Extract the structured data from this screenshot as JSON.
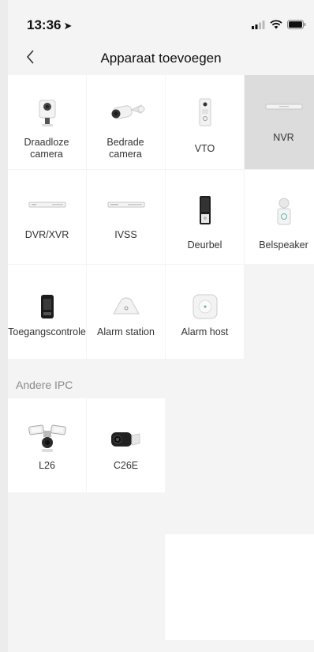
{
  "status": {
    "time": "13:36",
    "location_icon": "location-arrow-icon"
  },
  "nav": {
    "back_icon": "chevron-left-icon",
    "title": "Apparaat toevoegen"
  },
  "devices": [
    {
      "label": "Draadloze camera",
      "icon": "wireless-camera-icon"
    },
    {
      "label": "Bedrade camera",
      "icon": "bullet-camera-icon"
    },
    {
      "label": "VTO",
      "icon": "door-station-icon"
    },
    {
      "label": "NVR",
      "icon": "nvr-recorder-icon",
      "selected": true
    },
    {
      "label": "DVR/XVR",
      "icon": "dvr-recorder-icon"
    },
    {
      "label": "IVSS",
      "icon": "ivss-recorder-icon"
    },
    {
      "label": "Deurbel",
      "icon": "doorbell-icon"
    },
    {
      "label": "Belspeaker",
      "icon": "chime-icon"
    },
    {
      "label": "Toegangscontrole",
      "icon": "access-control-icon"
    },
    {
      "label": "Alarm station",
      "icon": "alarm-station-icon"
    },
    {
      "label": "Alarm host",
      "icon": "alarm-host-icon"
    }
  ],
  "other_section": {
    "title": "Andere IPC",
    "items": [
      {
        "label": "L26",
        "icon": "floodlight-camera-icon"
      },
      {
        "label": "C26E",
        "icon": "bullet-camera-black-icon"
      }
    ]
  },
  "colors": {
    "background": "#f4f4f4",
    "cell": "#ffffff",
    "selected": "#dcdcdc",
    "section_text": "#8a8a8a"
  }
}
